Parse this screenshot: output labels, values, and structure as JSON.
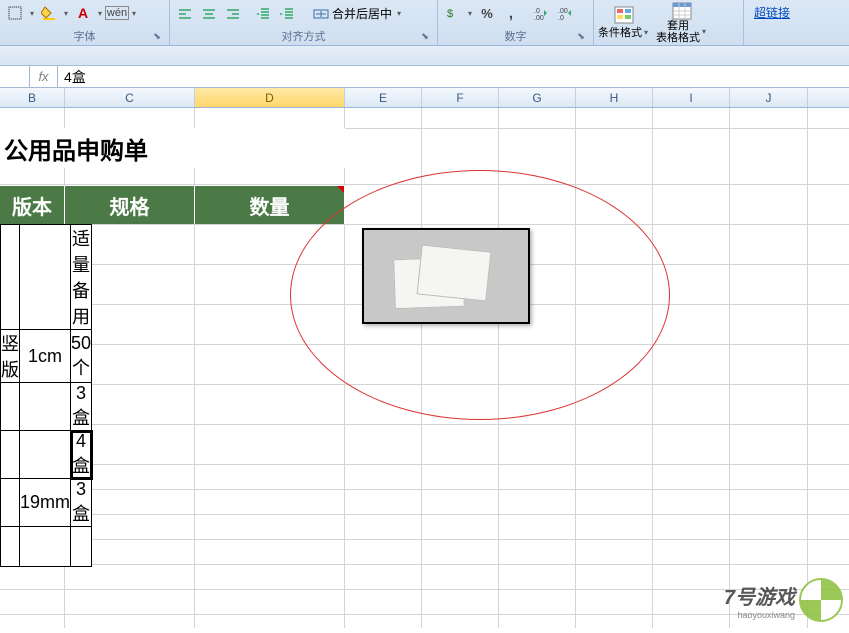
{
  "ribbon": {
    "font_group_label": "字体",
    "align_group_label": "对齐方式",
    "number_group_label": "数字",
    "merge_center_label": "合并后居中",
    "cond_format_label": "条件格式",
    "format_table_label": "套用\n表格格式",
    "hyperlink_label": "超链接"
  },
  "formula_bar": {
    "fx": "fx",
    "value": "4盒"
  },
  "columns": {
    "B": "B",
    "C": "C",
    "D": "D",
    "E": "E",
    "F": "F",
    "G": "G",
    "H": "H",
    "I": "I",
    "J": "J"
  },
  "sheet": {
    "title": "公用品申购单",
    "headers": {
      "b": "版本",
      "c": "规格",
      "d": "数量"
    },
    "rows": [
      {
        "b": "",
        "c": "",
        "d": "适量备用"
      },
      {
        "b": "竖版",
        "c": "1cm",
        "d": "50个"
      },
      {
        "b": "",
        "c": "",
        "d": "3盒"
      },
      {
        "b": "",
        "c": "",
        "d": "4盒"
      },
      {
        "b": "",
        "c": "19mm",
        "d": "3盒"
      },
      {
        "b": "",
        "c": "",
        "d": ""
      }
    ],
    "selected_row": 3
  },
  "watermark": {
    "text": "7号游戏",
    "sub": "haoyouxiwang"
  }
}
